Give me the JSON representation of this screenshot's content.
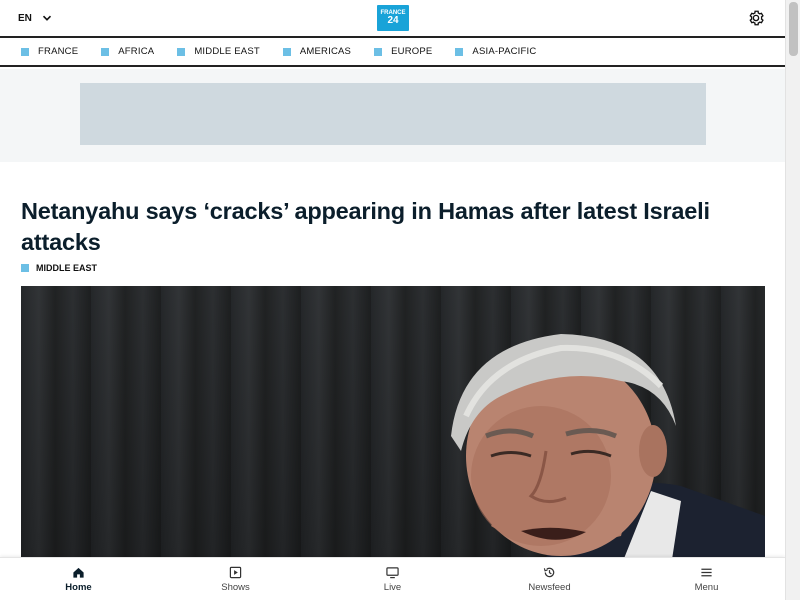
{
  "header": {
    "language": "EN",
    "logo_top": "FRANCE",
    "logo_num": "24"
  },
  "nav": {
    "items": [
      {
        "label": "FRANCE"
      },
      {
        "label": "AFRICA"
      },
      {
        "label": "MIDDLE EAST"
      },
      {
        "label": "AMERICAS"
      },
      {
        "label": "EUROPE"
      },
      {
        "label": "ASIA-PACIFIC"
      }
    ]
  },
  "article": {
    "headline": "Netanyahu says ‘cracks’ appearing in Hamas after latest Israeli attacks",
    "category": "MIDDLE EAST"
  },
  "tabbar": {
    "items": [
      {
        "label": "Home",
        "icon": "home-icon",
        "active": true
      },
      {
        "label": "Shows",
        "icon": "play-icon"
      },
      {
        "label": "Live",
        "icon": "tv-icon"
      },
      {
        "label": "Newsfeed",
        "icon": "history-icon"
      },
      {
        "label": "Menu",
        "icon": "menu-icon"
      }
    ]
  },
  "colors": {
    "accent": "#6cbfe5",
    "logo": "#19a3d8",
    "headline": "#0b1e2b",
    "ad_placeholder": "#cfd9df"
  }
}
